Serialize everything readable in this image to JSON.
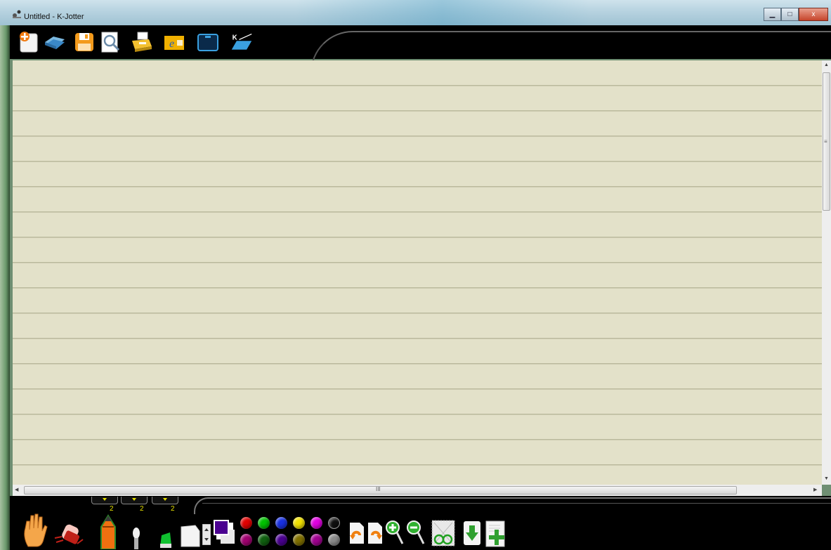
{
  "window": {
    "title": "Untitled - K-Jotter",
    "controls": {
      "minimize": "▁",
      "maximize": "□",
      "close": "x"
    }
  },
  "toolbar_top": {
    "buttons": [
      "new-icon",
      "open-icon",
      "save-icon",
      "preview-icon",
      "print-icon",
      "browser-icon",
      "window-icon",
      "kjotter-tablet-icon"
    ]
  },
  "scrollbars": {
    "vertical_grip": "≡",
    "horizontal_grip": "III"
  },
  "tool_sizes": {
    "pencil_size": "2",
    "brush_size": "2",
    "highlighter_size": "2"
  },
  "palette": {
    "row1": [
      "#e00000",
      "#00c000",
      "#1830e0",
      "#f0e000",
      "#e000e0",
      "#101010"
    ],
    "row2": [
      "#a00070",
      "#106010",
      "#4a0090",
      "#807000",
      "#a00090",
      "#8a8a8a"
    ],
    "foreground": "#4a0090",
    "background": "#e8e8e8"
  },
  "colors": {
    "paper": "#e3e1c9",
    "ruled_line": "#b9b89b",
    "toolbar": "#000000"
  }
}
